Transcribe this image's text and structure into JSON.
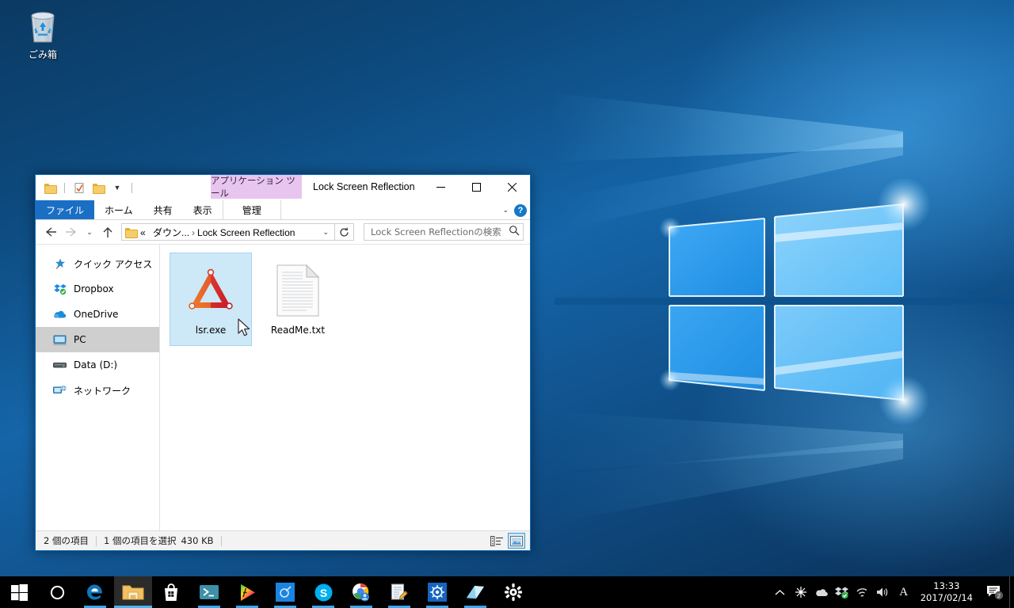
{
  "desktop": {
    "recycle_bin": {
      "label": "ごみ箱",
      "icon": "recycle-bin-icon"
    },
    "wallpaper": "windows-10-hero-logo"
  },
  "explorer": {
    "quick_access_toolbar": {
      "items": [
        {
          "name": "folder-properties-icon",
          "label": ""
        },
        {
          "name": "properties-checkmark-icon",
          "label": ""
        },
        {
          "name": "new-folder-icon",
          "label": ""
        },
        {
          "name": "customize-qat-chevron-icon",
          "label": ""
        }
      ]
    },
    "contextual_tab_group": "アプリケーション ツール",
    "title": "Lock Screen Reflection",
    "window_buttons": {
      "minimize": "minimize-icon",
      "maximize": "maximize-icon",
      "close": "close-icon"
    },
    "ribbon": {
      "tabs": [
        {
          "label": "ファイル",
          "active": true
        },
        {
          "label": "ホーム",
          "active": false
        },
        {
          "label": "共有",
          "active": false
        },
        {
          "label": "表示",
          "active": false
        },
        {
          "label": "管理",
          "active": false
        }
      ],
      "collapse_icon": "chevron-down-icon",
      "help_label": "?"
    },
    "address_bar": {
      "back_icon": "arrow-left-icon",
      "forward_icon": "arrow-right-icon",
      "recent_icon": "chevron-down-icon",
      "up_icon": "arrow-up-icon",
      "folder_icon": "folder-icon",
      "crumb_overflow": "«",
      "crumb_parent": "ダウン...",
      "crumb_current": "Lock Screen Reflection",
      "dropdown_icon": "chevron-down-icon",
      "refresh_icon": "refresh-icon"
    },
    "search": {
      "placeholder": "Lock Screen Reflectionの検索",
      "value": "",
      "icon": "search-icon"
    },
    "nav_pane": {
      "items": [
        {
          "label": "クイック アクセス",
          "icon": "star-pin-icon",
          "selected": false
        },
        {
          "label": "Dropbox",
          "icon": "dropbox-icon",
          "selected": false
        },
        {
          "label": "OneDrive",
          "icon": "onedrive-cloud-icon",
          "selected": false
        },
        {
          "label": "PC",
          "icon": "computer-icon",
          "selected": true
        },
        {
          "label": "Data (D:)",
          "icon": "hard-drive-icon",
          "selected": false
        },
        {
          "label": "ネットワーク",
          "icon": "network-icon",
          "selected": false
        }
      ]
    },
    "files": [
      {
        "name": "lsr.exe",
        "icon": "warning-triangle-app-icon",
        "selected": true
      },
      {
        "name": "ReadMe.txt",
        "icon": "text-file-icon",
        "selected": false
      }
    ],
    "status_bar": {
      "item_count": "2 個の項目",
      "selection": "1 個の項目を選択",
      "size": "430 KB",
      "views": [
        {
          "name": "details-view-button",
          "active": false
        },
        {
          "name": "large-icons-view-button",
          "active": true
        }
      ]
    }
  },
  "taskbar": {
    "buttons": [
      {
        "name": "start-button",
        "icon": "windows-logo-icon",
        "running": false,
        "active": false
      },
      {
        "name": "cortana-search-button",
        "icon": "cortana-circle-icon",
        "running": false,
        "active": false
      },
      {
        "name": "edge-button",
        "icon": "edge-icon",
        "running": true,
        "active": false
      },
      {
        "name": "file-explorer-button",
        "icon": "folder-icon",
        "running": true,
        "active": true
      },
      {
        "name": "microsoft-store-button",
        "icon": "store-bag-icon",
        "running": false,
        "active": false
      },
      {
        "name": "powershell-button",
        "icon": "powershell-icon",
        "running": true,
        "active": false
      },
      {
        "name": "resilio-sync-button",
        "icon": "rainbow-play-icon",
        "running": true,
        "active": false
      },
      {
        "name": "app-blue-button",
        "icon": "blue-comet-icon",
        "running": true,
        "active": false
      },
      {
        "name": "skype-button",
        "icon": "skype-icon",
        "running": true,
        "active": false
      },
      {
        "name": "chrome-button",
        "icon": "chrome-contact-icon",
        "running": true,
        "active": false
      },
      {
        "name": "notepad-editor-button",
        "icon": "notepad-pencil-icon",
        "running": true,
        "active": false
      },
      {
        "name": "app-gear-blue-button",
        "icon": "blue-gear-square-icon",
        "running": true,
        "active": false
      },
      {
        "name": "sticky-notes-button",
        "icon": "sticky-note-icon",
        "running": true,
        "active": false
      },
      {
        "name": "settings-button",
        "icon": "gear-icon",
        "running": false,
        "active": false
      }
    ],
    "tray": {
      "show_hidden_icon": "chevron-up-icon",
      "icons": [
        {
          "name": "tray-snowflake-icon"
        },
        {
          "name": "tray-onedrive-icon"
        },
        {
          "name": "tray-dropbox-icon"
        },
        {
          "name": "tray-wifi-icon"
        },
        {
          "name": "tray-volume-icon"
        },
        {
          "name": "tray-ime-icon",
          "label": "A"
        }
      ],
      "clock": {
        "time": "13:33",
        "date": "2017/02/14"
      },
      "notifications": {
        "icon": "notification-icon",
        "badge": "2"
      },
      "show_desktop": "show-desktop-button"
    }
  }
}
